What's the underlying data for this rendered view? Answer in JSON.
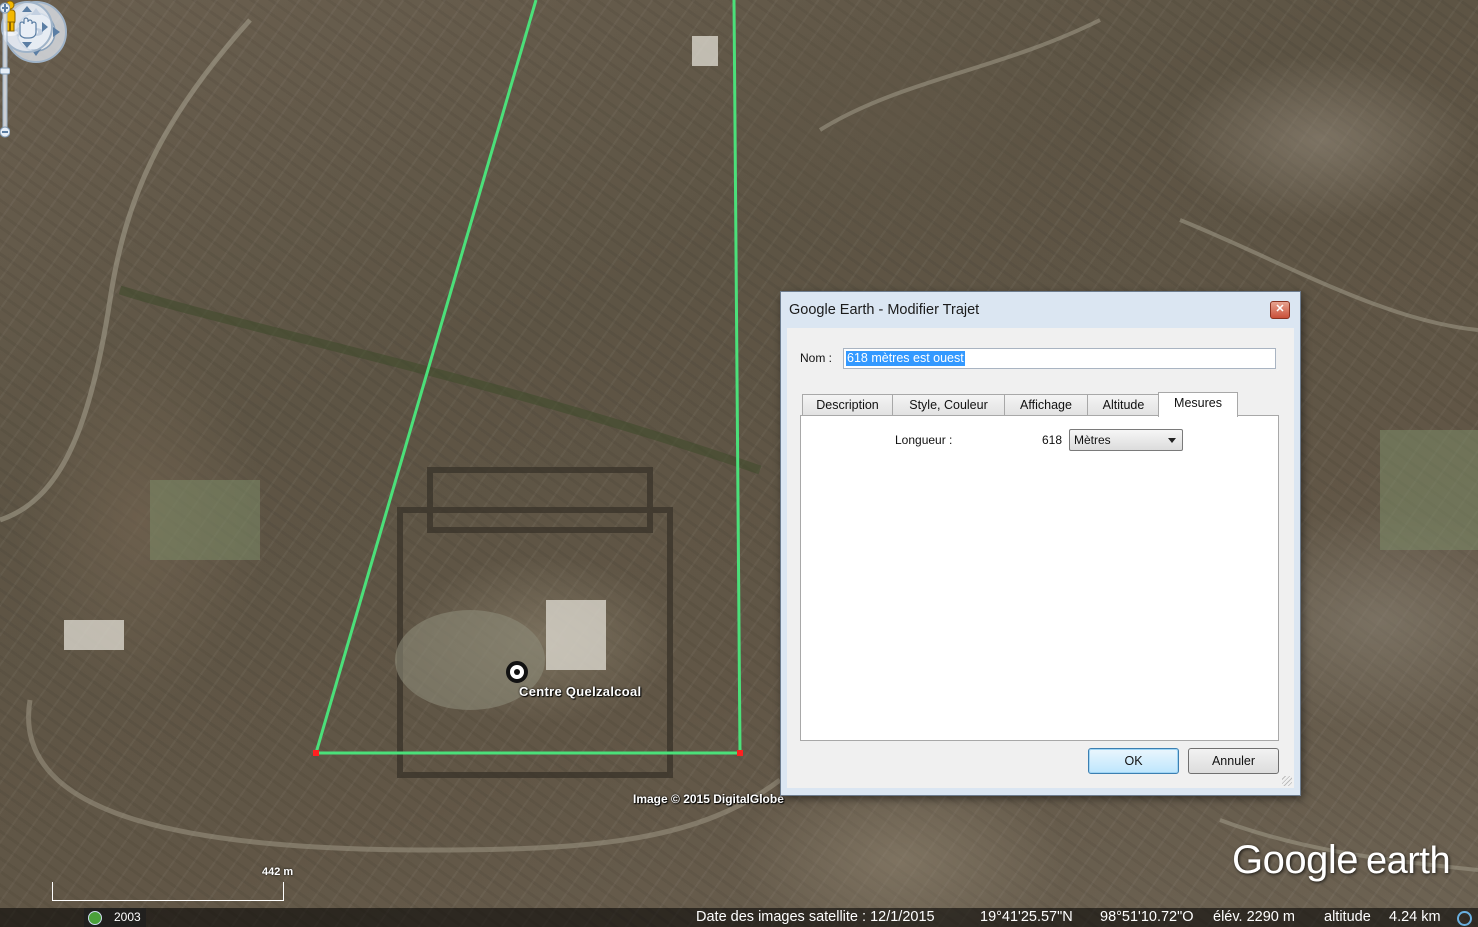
{
  "map": {
    "place_label": "Centre Quelzalcoal",
    "copyright": "Image © 2015 DigitalGlobe",
    "logo_text_1": "Google",
    "logo_text_2": "earth",
    "scale_label": "442 m",
    "path_color": "#4be07a",
    "endpoint_color": "#ff2020"
  },
  "status_bar": {
    "year": "2003",
    "imagery_date": "Date des images satellite : 12/1/2015",
    "latitude": "19°41'25.57\"N",
    "longitude": "98°51'10.72\"O",
    "elevation": "élév. 2290 m",
    "altitude_label": "altitude",
    "altitude_value": "4.24 km"
  },
  "nav_controls": {
    "look": "look-joystick-icon",
    "move": "hand-move-icon",
    "street_view": "pegman-icon",
    "zoom_in": "+",
    "zoom_out": "−"
  },
  "dialog": {
    "title": "Google Earth - Modifier Trajet",
    "close_glyph": "✕",
    "name_label": "Nom :",
    "name_value": "618 mètres est ouest",
    "tabs": [
      {
        "label": "Description",
        "active": false
      },
      {
        "label": "Style, Couleur",
        "active": false
      },
      {
        "label": "Affichage",
        "active": false
      },
      {
        "label": "Altitude",
        "active": false
      },
      {
        "label": "Mesures",
        "active": true
      }
    ],
    "length_label": "Longueur :",
    "length_value": "618",
    "unit_selected": "Mètres",
    "ok_label": "OK",
    "cancel_label": "Annuler"
  }
}
